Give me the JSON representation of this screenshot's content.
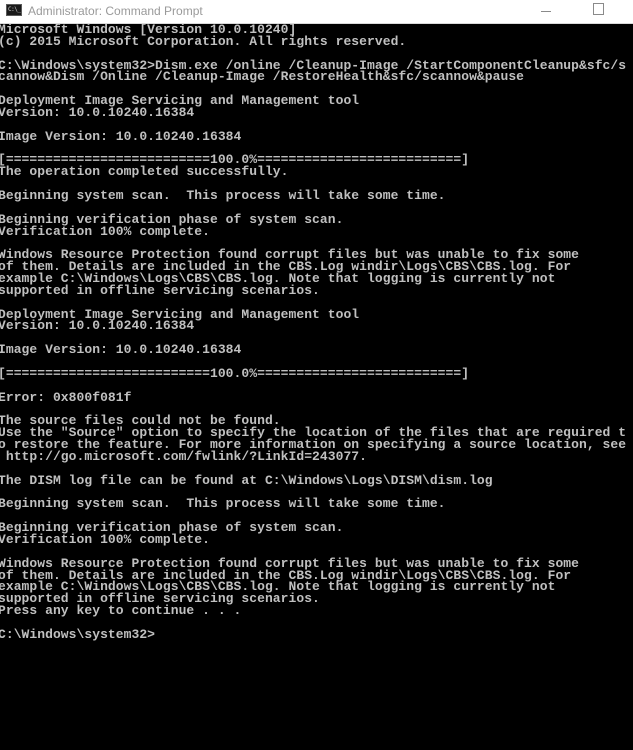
{
  "window": {
    "title": "Administrator: Command Prompt",
    "icon": "cmd-icon",
    "icon_text": "C:\\_",
    "controls": {
      "minimize": "minimize-icon",
      "maximize": "maximize-icon"
    }
  },
  "console": {
    "text_color": "#c0c0c0",
    "background": "#000000",
    "lines": [
      "Microsoft Windows [Version 10.0.10240]",
      "(c) 2015 Microsoft Corporation. All rights reserved.",
      "",
      "C:\\Windows\\system32>Dism.exe /online /Cleanup-Image /StartComponentCleanup&sfc/s",
      "cannow&Dism /Online /Cleanup-Image /RestoreHealth&sfc/scannow&pause",
      "",
      "Deployment Image Servicing and Management tool",
      "Version: 10.0.10240.16384",
      "",
      "Image Version: 10.0.10240.16384",
      "",
      "[==========================100.0%==========================]",
      "The operation completed successfully.",
      "",
      "Beginning system scan.  This process will take some time.",
      "",
      "Beginning verification phase of system scan.",
      "Verification 100% complete.",
      "",
      "Windows Resource Protection found corrupt files but was unable to fix some",
      "of them. Details are included in the CBS.Log windir\\Logs\\CBS\\CBS.log. For",
      "example C:\\Windows\\Logs\\CBS\\CBS.log. Note that logging is currently not",
      "supported in offline servicing scenarios.",
      "",
      "Deployment Image Servicing and Management tool",
      "Version: 10.0.10240.16384",
      "",
      "Image Version: 10.0.10240.16384",
      "",
      "[==========================100.0%==========================]",
      "",
      "Error: 0x800f081f",
      "",
      "The source files could not be found.",
      "Use the \"Source\" option to specify the location of the files that are required t",
      "o restore the feature. For more information on specifying a source location, see",
      " http://go.microsoft.com/fwlink/?LinkId=243077.",
      "",
      "The DISM log file can be found at C:\\Windows\\Logs\\DISM\\dism.log",
      "",
      "Beginning system scan.  This process will take some time.",
      "",
      "Beginning verification phase of system scan.",
      "Verification 100% complete.",
      "",
      "Windows Resource Protection found corrupt files but was unable to fix some",
      "of them. Details are included in the CBS.Log windir\\Logs\\CBS\\CBS.log. For",
      "example C:\\Windows\\Logs\\CBS\\CBS.log. Note that logging is currently not",
      "supported in offline servicing scenarios.",
      "Press any key to continue . . .",
      "",
      "C:\\Windows\\system32>"
    ]
  }
}
